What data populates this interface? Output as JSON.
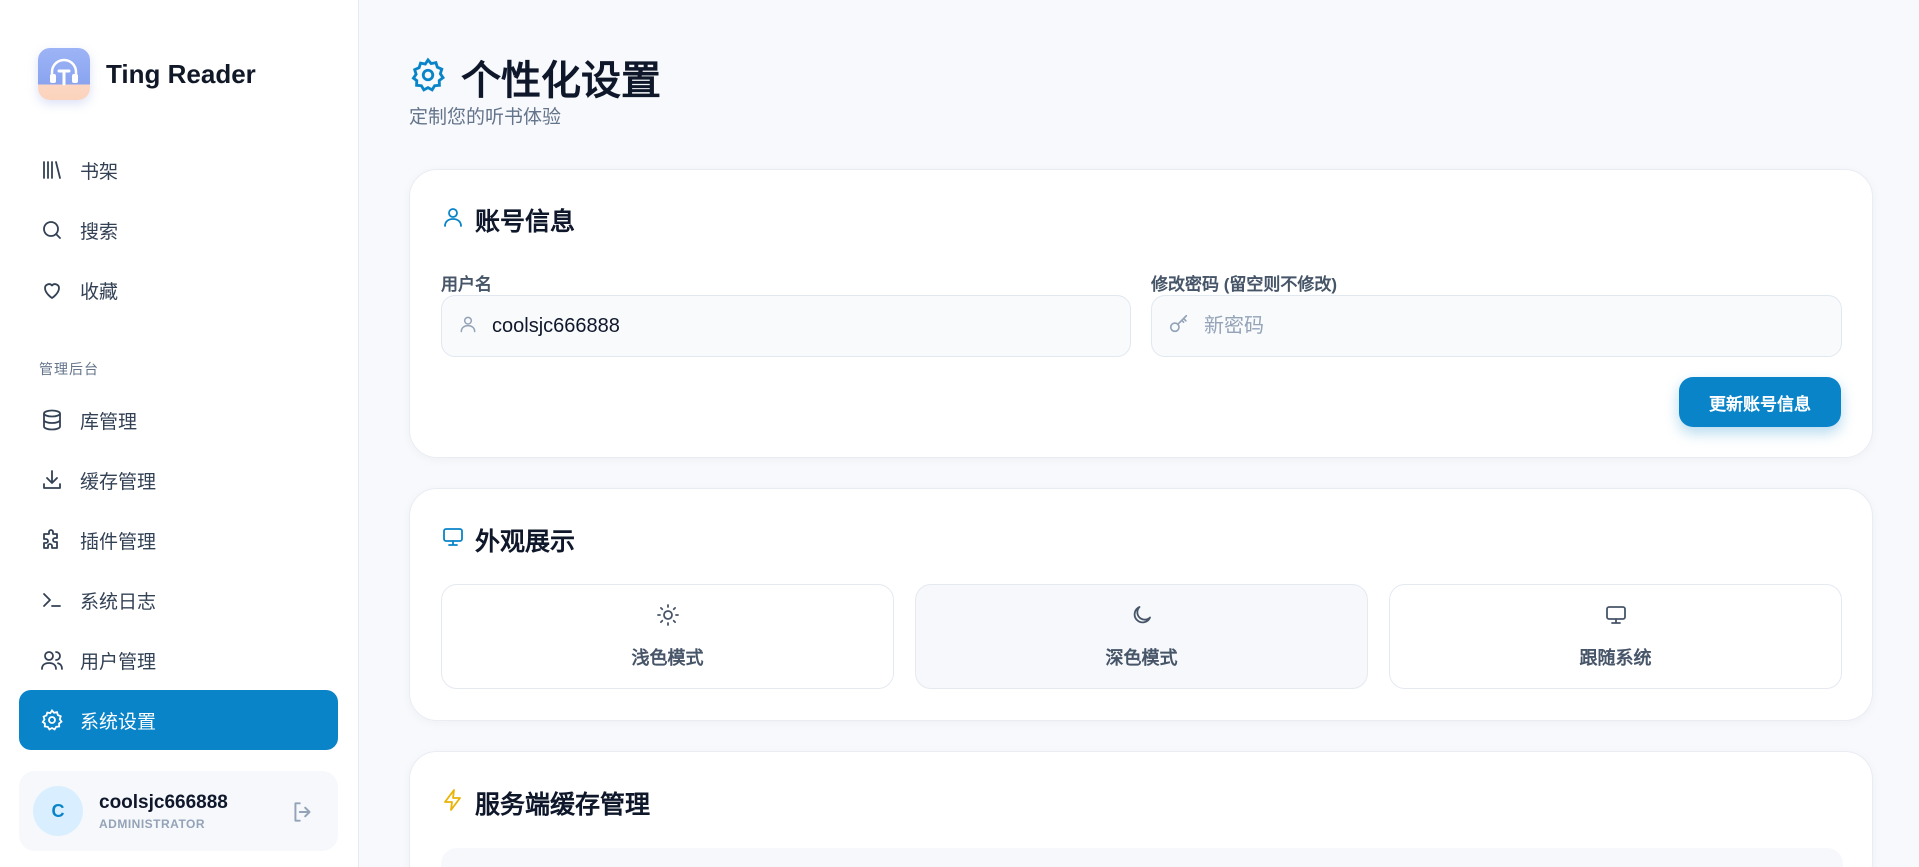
{
  "brand": {
    "name": "Ting Reader"
  },
  "sidebar": {
    "nav_main": [
      {
        "label": "书架",
        "icon": "library-icon"
      },
      {
        "label": "搜索",
        "icon": "search-icon"
      },
      {
        "label": "收藏",
        "icon": "heart-icon"
      }
    ],
    "section_label": "管理后台",
    "nav_admin": [
      {
        "label": "库管理",
        "icon": "database-icon"
      },
      {
        "label": "缓存管理",
        "icon": "download-icon"
      },
      {
        "label": "插件管理",
        "icon": "puzzle-icon"
      },
      {
        "label": "系统日志",
        "icon": "terminal-icon"
      },
      {
        "label": "用户管理",
        "icon": "users-icon"
      },
      {
        "label": "系统设置",
        "icon": "gear-icon",
        "active": true
      }
    ],
    "user": {
      "initial": "C",
      "name": "coolsjc666888",
      "role": "ADMINISTRATOR"
    }
  },
  "page": {
    "title": "个性化设置",
    "subtitle": "定制您的听书体验"
  },
  "account": {
    "title": "账号信息",
    "username_label": "用户名",
    "username_value": "coolsjc666888",
    "password_label": "修改密码 (留空则不修改)",
    "password_placeholder": "新密码",
    "update_button": "更新账号信息"
  },
  "appearance": {
    "title": "外观展示",
    "options": [
      {
        "label": "浅色模式",
        "icon": "sun-icon"
      },
      {
        "label": "深色模式",
        "icon": "moon-icon",
        "selected": true
      },
      {
        "label": "跟随系统",
        "icon": "monitor-icon"
      }
    ]
  },
  "cache": {
    "title": "服务端缓存管理"
  },
  "colors": {
    "accent": "#0a84c8",
    "bolt": "#eab308"
  }
}
